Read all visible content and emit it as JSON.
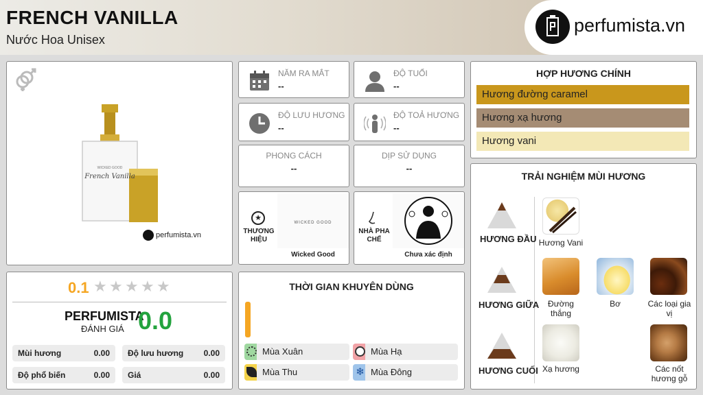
{
  "header": {
    "title": "FRENCH VANILLA",
    "subtitle": "Nước Hoa Unisex",
    "logo_text": "perfumista.vn"
  },
  "product": {
    "bottle_script": "French Vanilla",
    "bottle_brand": "WICKED GOOD",
    "watermark": "perfumista.vn",
    "gender_icon": "gender-unisex-icon"
  },
  "info": {
    "release": {
      "label": "NĂM RA MẮT",
      "value": "--"
    },
    "age": {
      "label": "ĐỘ TUỔI",
      "value": "--"
    },
    "longevity": {
      "label": "ĐỘ LƯU HƯƠNG",
      "value": "--"
    },
    "sillage": {
      "label": "ĐỘ TOẢ HƯƠNG",
      "value": "--"
    },
    "style": {
      "label": "PHONG CÁCH",
      "value": "--"
    },
    "occasion": {
      "label": "DỊP SỬ DỤNG",
      "value": "--"
    }
  },
  "brand": {
    "label": "THƯƠNG HIỆU",
    "name": "Wicked Good",
    "logo_text": "WICKED GOOD"
  },
  "perfumer": {
    "label": "NHÀ PHA CHẾ",
    "name": "Chưa xác định"
  },
  "accords": {
    "title": "HỢP HƯƠNG CHÍNH",
    "items": [
      {
        "label": "Hương đường caramel",
        "color": "#c9971c"
      },
      {
        "label": "Hương xạ hương",
        "color": "#a58c74"
      },
      {
        "label": "Hương vani",
        "color": "#f3e8b6"
      }
    ]
  },
  "notes": {
    "title": "TRẢI NGHIỆM MÙI HƯƠNG",
    "top": {
      "label": "HƯƠNG ĐẦU",
      "items": [
        "Hương Vani"
      ]
    },
    "middle": {
      "label": "HƯƠNG GIỮA",
      "items": [
        "Đường thắng",
        "Bơ",
        "Các loại gia vị"
      ]
    },
    "base": {
      "label": "HƯƠNG CUỐI",
      "items": [
        "Xạ hương",
        "Các nốt hương gỗ"
      ]
    }
  },
  "rating": {
    "score": "0.1",
    "stars": 5,
    "brand": "PERFUMISTA",
    "sub": "ĐÁNH GIÁ",
    "value": "0.0",
    "stats": [
      {
        "label": "Mùi hương",
        "value": "0.00"
      },
      {
        "label": "Độ lưu hương",
        "value": "0.00"
      },
      {
        "label": "Độ phổ biến",
        "value": "0.00"
      },
      {
        "label": "Giá",
        "value": "0.00"
      }
    ]
  },
  "time": {
    "title": "THỜI GIAN KHUYÊN DÙNG",
    "seasons": [
      {
        "label": "Mùa Xuân",
        "color": "#9fd8a0",
        "icon": "flower-icon"
      },
      {
        "label": "Mùa Hạ",
        "color": "#f2a3a7",
        "icon": "sun-icon"
      },
      {
        "label": "Mùa Thu",
        "color": "#f4d34a",
        "icon": "leaf-icon"
      },
      {
        "label": "Mùa Đông",
        "color": "#9fc4ea",
        "icon": "snowflake-icon"
      }
    ]
  },
  "colors": {
    "accent_orange": "#f5a623",
    "score_green": "#23a33e"
  }
}
